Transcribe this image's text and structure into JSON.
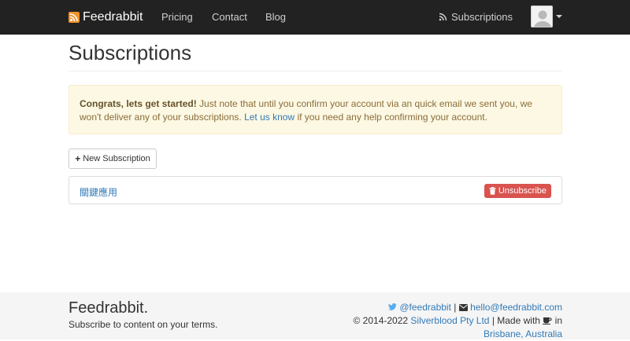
{
  "navbar": {
    "brand": "Feedrabbit",
    "links": [
      "Pricing",
      "Contact",
      "Blog"
    ],
    "subscriptions_label": "Subscriptions"
  },
  "page": {
    "title": "Subscriptions"
  },
  "alert": {
    "strong": "Congrats, lets get started!",
    "text1": " Just note that until you confirm your account via an quick email we sent you, we won't deliver any of your subscriptions. ",
    "link": "Let us know",
    "text2": " if you need any help confirming your account."
  },
  "toolbar": {
    "new_label": "New Subscription"
  },
  "subscriptions": [
    {
      "name": "關鍵應用",
      "action_label": "Unsubscribe"
    }
  ],
  "footer": {
    "brand": "Feedrabbit.",
    "tagline": "Subscribe to content on your terms.",
    "twitter": "@feedrabbit",
    "email": "hello@feedrabbit.com",
    "copyright": "© 2014-2022",
    "company": "Silverblood Pty Ltd",
    "made_with": "| Made with",
    "in": "in",
    "location": "Brisbane, Australia"
  },
  "colors": {
    "navbar": "#222222",
    "accent_orange": "#f0932b",
    "link": "#337ab7",
    "danger": "#d9534f",
    "alert_bg": "#fcf8e3"
  },
  "icons": [
    "rss-icon",
    "avatar-icon",
    "caret-down-icon",
    "plus-icon",
    "trash-icon",
    "twitter-icon",
    "envelope-icon",
    "coffee-icon"
  ]
}
